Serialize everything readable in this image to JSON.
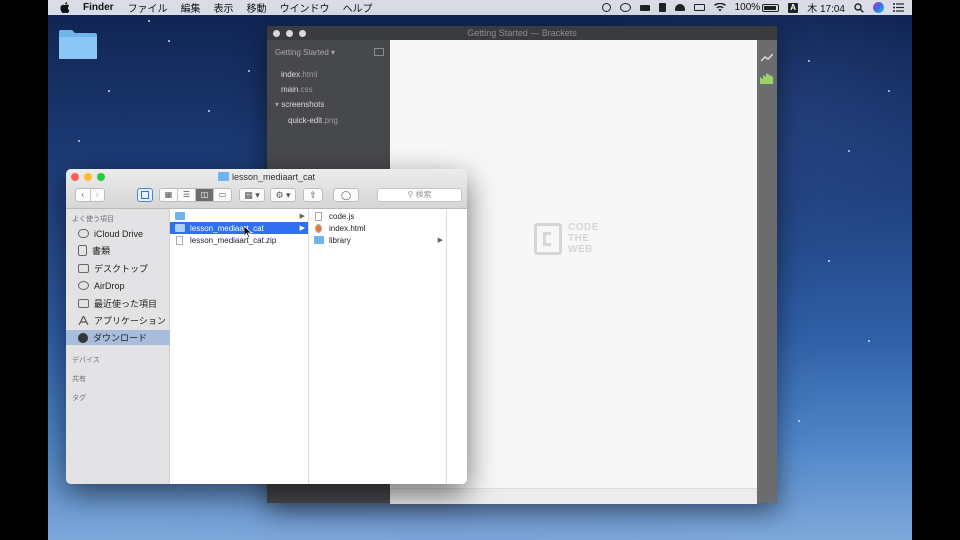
{
  "menubar": {
    "app_name": "Finder",
    "menus": [
      "ファイル",
      "編集",
      "表示",
      "移動",
      "ウインドウ",
      "ヘルプ"
    ],
    "battery": "100%",
    "input_mode": "A",
    "clock": "木 17:04"
  },
  "brackets": {
    "title": "Getting Started — Brackets",
    "project": "Getting Started",
    "files": [
      {
        "name": "index",
        "ext": ".html"
      },
      {
        "name": "main",
        "ext": ".css"
      },
      {
        "name": "screenshots",
        "ext": ""
      },
      {
        "name": "quick-edit",
        "ext": ".png"
      }
    ],
    "logo_lines": [
      "CODE",
      "THE",
      "WEB"
    ]
  },
  "finder": {
    "title": "lesson_mediaart_cat",
    "search_placeholder": "検索",
    "sidebar": {
      "favorites_header": "よく使う項目",
      "items": [
        "iCloud Drive",
        "書類",
        "デスクトップ",
        "AirDrop",
        "最近使った項目",
        "アプリケーション",
        "ダウンロード"
      ],
      "devices_header": "デバイス",
      "shared_header": "共有",
      "tags_header": "タグ"
    },
    "column1": [
      {
        "name": "",
        "type": "folder"
      },
      {
        "name": "lesson_mediaart_cat",
        "type": "folder",
        "selected": true
      },
      {
        "name": "lesson_mediaart_cat.zip",
        "type": "file"
      }
    ],
    "column2": [
      {
        "name": "code.js",
        "type": "file"
      },
      {
        "name": "index.html",
        "type": "file"
      },
      {
        "name": "library",
        "type": "folder"
      }
    ]
  },
  "colors": {
    "selection": "#2f6ff0",
    "folder": "#6eb4ee",
    "sidebar_selection": "#a7bddb"
  }
}
